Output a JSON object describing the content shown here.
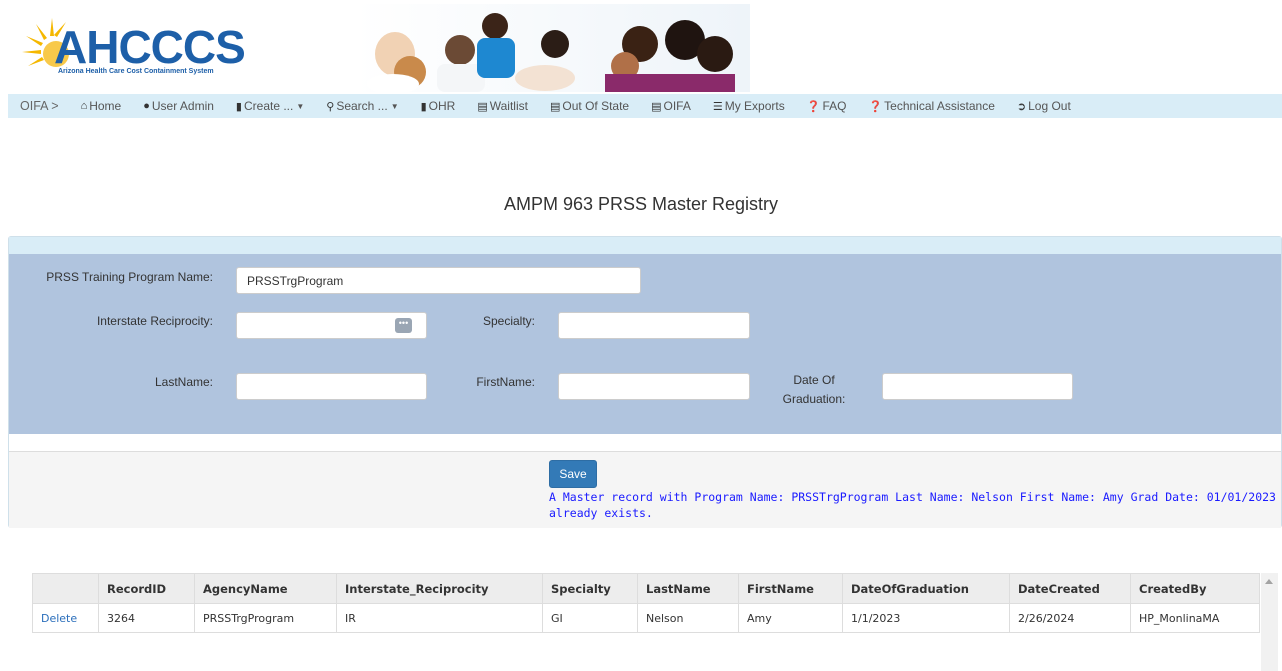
{
  "header": {
    "logo_text": "AHCCCS",
    "logo_subtitle": "Arizona Health Care Cost Containment System"
  },
  "nav": {
    "brand": "OIFA >",
    "items": [
      {
        "label": "Home",
        "icon": "home-icon"
      },
      {
        "label": "User Admin",
        "icon": "user-icon"
      },
      {
        "label": "Create ...",
        "icon": "file-icon",
        "dropdown": true
      },
      {
        "label": "Search ...",
        "icon": "search-icon",
        "dropdown": true
      },
      {
        "label": "OHR",
        "icon": "file-icon"
      },
      {
        "label": "Waitlist",
        "icon": "list-icon"
      },
      {
        "label": "Out Of State",
        "icon": "list-icon"
      },
      {
        "label": "OIFA",
        "icon": "list-icon"
      },
      {
        "label": "My Exports",
        "icon": "list-icon"
      },
      {
        "label": "FAQ",
        "icon": "question-icon"
      },
      {
        "label": "Technical Assistance",
        "icon": "question-icon"
      },
      {
        "label": "Log Out",
        "icon": "logout-icon"
      }
    ]
  },
  "page": {
    "title": "AMPM 963 PRSS Master Registry"
  },
  "form": {
    "program_name_label": "PRSS Training Program Name:",
    "program_name_value": "PRSSTrgProgram",
    "reciprocity_label": "Interstate Reciprocity:",
    "reciprocity_value": "",
    "specialty_label": "Specialty:",
    "specialty_value": "",
    "lastname_label": "LastName:",
    "lastname_value": "",
    "firstname_label": "FirstName:",
    "firstname_value": "",
    "graduation_label_line1": "Date Of",
    "graduation_label_line2": "Graduation:",
    "graduation_value": "",
    "picker_glyph": "•••",
    "save_label": "Save",
    "message": "A Master record with Program Name: PRSSTrgProgram Last Name: Nelson First Name: Amy Grad Date: 01/01/2023 already exists."
  },
  "grid": {
    "columns": [
      "",
      "RecordID",
      "AgencyName",
      "Interstate_Reciprocity",
      "Specialty",
      "LastName",
      "FirstName",
      "DateOfGraduation",
      "DateCreated",
      "CreatedBy"
    ],
    "rows": [
      [
        "Delete",
        "3264",
        "PRSSTrgProgram",
        "IR",
        "GI",
        "Nelson",
        "Amy",
        "1/1/2023",
        "2/26/2024",
        "HP_MonlinaMA"
      ]
    ]
  },
  "colors": {
    "brand_blue": "#1d5fa8",
    "nav_bg": "#d9edf7",
    "form_bg": "#b0c4de",
    "primary_button": "#337ab7",
    "message_text": "#1a1aff",
    "link": "#2a6ebb"
  }
}
